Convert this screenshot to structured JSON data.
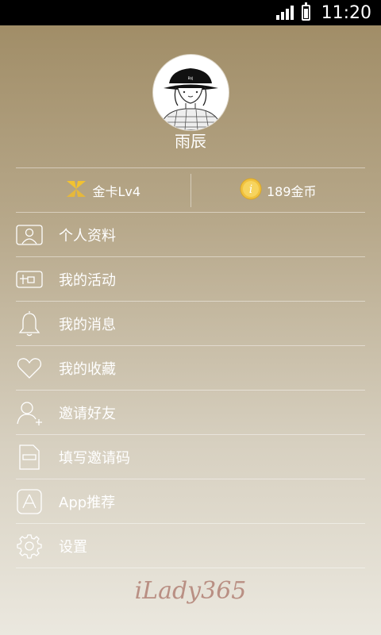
{
  "status_bar": {
    "time": "11:20"
  },
  "profile": {
    "name": "雨辰"
  },
  "stats": [
    {
      "icon": "gold-card-icon",
      "label": "金卡Lv4"
    },
    {
      "icon": "coin-icon",
      "label": "189金币"
    }
  ],
  "menu": [
    {
      "icon": "profile-card-icon",
      "label": "个人资料"
    },
    {
      "icon": "activity-ticket-icon",
      "label": "我的活动"
    },
    {
      "icon": "bell-icon",
      "label": "我的消息"
    },
    {
      "icon": "heart-icon",
      "label": "我的收藏"
    },
    {
      "icon": "add-user-icon",
      "label": "邀请好友"
    },
    {
      "icon": "document-icon",
      "label": "填写邀请码"
    },
    {
      "icon": "app-store-icon",
      "label": "App推荐"
    },
    {
      "icon": "gear-icon",
      "label": "设置"
    }
  ],
  "footer": {
    "brand": "iLady365"
  },
  "colors": {
    "accent_gold": "#e6b83b",
    "brand": "#b98f83"
  }
}
